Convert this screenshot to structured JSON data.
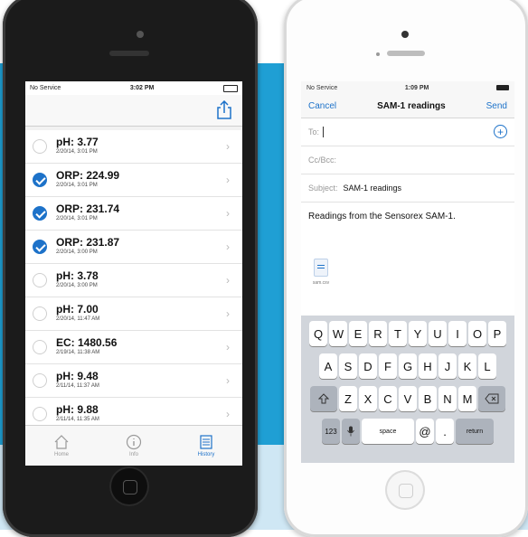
{
  "left_phone": {
    "status": {
      "carrier": "No Service",
      "time": "3:02 PM"
    },
    "share_icon": "share-icon",
    "readings": [
      {
        "value": "pH: 3.77",
        "stamp": "2/20/14, 3:01 PM",
        "checked": false
      },
      {
        "value": "ORP: 224.99",
        "stamp": "2/20/14, 3:01 PM",
        "checked": true
      },
      {
        "value": "ORP: 231.74",
        "stamp": "2/20/14, 3:01 PM",
        "checked": true
      },
      {
        "value": "ORP: 231.87",
        "stamp": "2/20/14, 3:00 PM",
        "checked": true
      },
      {
        "value": "pH: 3.78",
        "stamp": "2/20/14, 3:00 PM",
        "checked": false
      },
      {
        "value": "pH: 7.00",
        "stamp": "2/20/14, 11:47 AM",
        "checked": false
      },
      {
        "value": "EC: 1480.56",
        "stamp": "2/19/14, 11:38 AM",
        "checked": false
      },
      {
        "value": "pH: 9.48",
        "stamp": "2/11/14, 11:37 AM",
        "checked": false
      },
      {
        "value": "pH: 9.88",
        "stamp": "2/11/14, 11:35 AM",
        "checked": false
      }
    ],
    "tabs": [
      {
        "label": "Home",
        "icon": "home-icon"
      },
      {
        "label": "Info",
        "icon": "info-icon"
      },
      {
        "label": "History",
        "icon": "history-icon"
      }
    ]
  },
  "right_phone": {
    "status": {
      "carrier": "No Service",
      "time": "1:09 PM"
    },
    "nav": {
      "cancel": "Cancel",
      "title": "SAM-1 readings",
      "send": "Send"
    },
    "to_label": "To:",
    "cc_label": "Cc/Bcc:",
    "subject_label": "Subject:",
    "subject_value": "SAM-1 readings",
    "body": "Readings from the Sensorex SAM-1.",
    "attachment_name": "sam.csv",
    "keyboard": {
      "row1": [
        "Q",
        "W",
        "E",
        "R",
        "T",
        "Y",
        "U",
        "I",
        "O",
        "P"
      ],
      "row2": [
        "A",
        "S",
        "D",
        "F",
        "G",
        "H",
        "J",
        "K",
        "L"
      ],
      "row3": [
        "Z",
        "X",
        "C",
        "V",
        "B",
        "N",
        "M"
      ],
      "numbers": "123",
      "space": "space",
      "at": "@",
      "dot": ".",
      "return": "return"
    }
  },
  "colors": {
    "accent": "#1d72c9",
    "band": "#1f9fd4"
  }
}
